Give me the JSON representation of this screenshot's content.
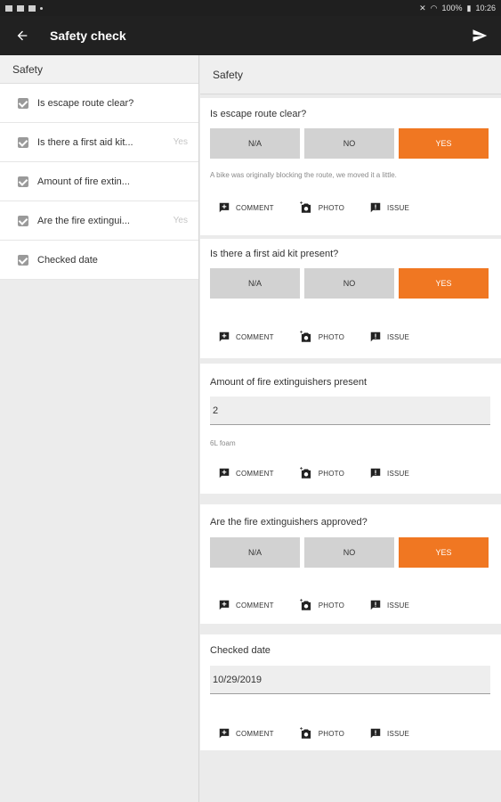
{
  "status_bar": {
    "battery": "100%",
    "time": "10:26"
  },
  "app_bar": {
    "title": "Safety check"
  },
  "sidebar": {
    "section_title": "Safety",
    "items": [
      {
        "label": "Is escape route clear?",
        "value": ""
      },
      {
        "label": "Is there a first aid kit...",
        "value": "Yes"
      },
      {
        "label": "Amount of fire extin...",
        "value": ""
      },
      {
        "label": "Are the fire extingui...",
        "value": "Yes"
      },
      {
        "label": "Checked date",
        "value": ""
      }
    ]
  },
  "main": {
    "section_title": "Safety",
    "questions": [
      {
        "question": "Is escape route clear?",
        "options": [
          "N/A",
          "NO",
          "YES"
        ],
        "selected": "YES",
        "note": "A bike was originally blocking the route, we moved it a little."
      },
      {
        "question": "Is there a first aid kit present?",
        "options": [
          "N/A",
          "NO",
          "YES"
        ],
        "selected": "YES"
      },
      {
        "question": "Amount of fire extinguishers present",
        "value": "2",
        "note": "6L foam"
      },
      {
        "question": "Are the fire extinguishers approved?",
        "options": [
          "N/A",
          "NO",
          "YES"
        ],
        "selected": "YES"
      },
      {
        "question": "Checked date",
        "value": "10/29/2019"
      }
    ],
    "actions": {
      "comment": "COMMENT",
      "photo": "PHOTO",
      "issue": "ISSUE"
    }
  },
  "colors": {
    "accent": "#f07722",
    "app_bar": "#212121",
    "status_bar": "#1f1f1f"
  }
}
